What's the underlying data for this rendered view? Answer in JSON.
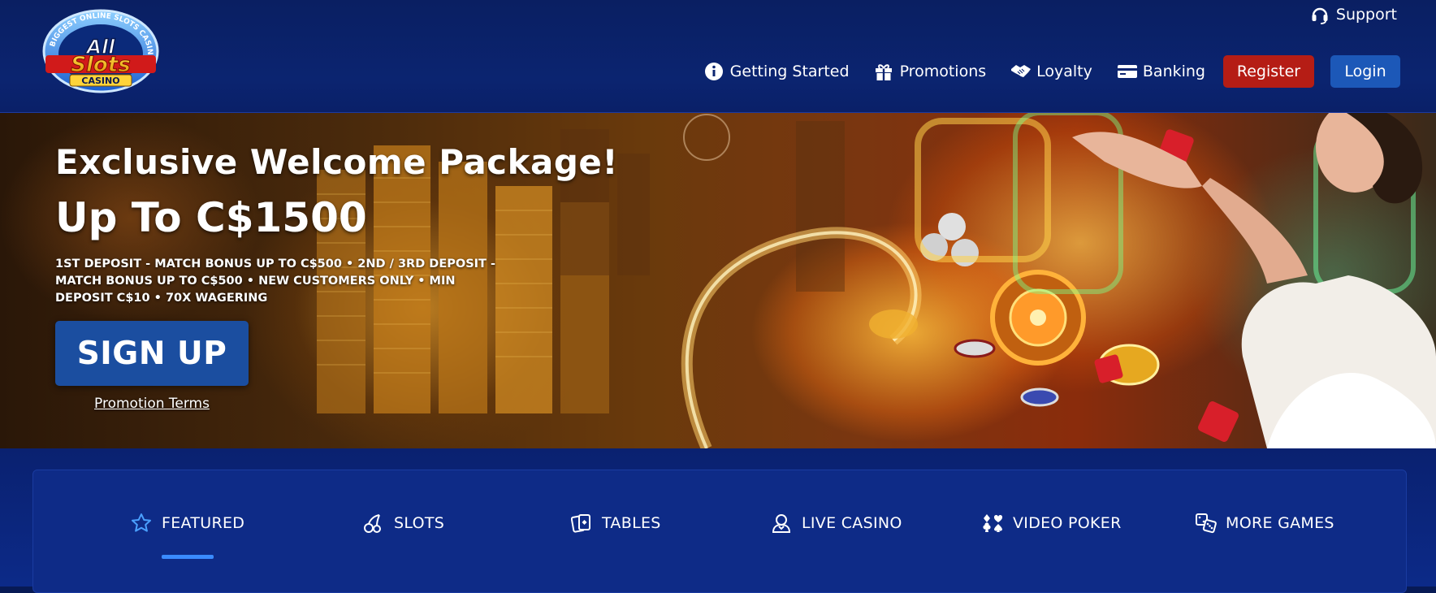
{
  "header": {
    "logo_alt": "All Slots Casino",
    "logo": {
      "ring_text": "BIGGEST ONLINE SLOTS CASINO",
      "line1": "All",
      "line2": "Slots",
      "line3": "CASINO"
    },
    "support_label": "Support",
    "nav": [
      {
        "label": "Getting Started",
        "icon": "info-icon"
      },
      {
        "label": "Promotions",
        "icon": "gift-icon"
      },
      {
        "label": "Loyalty",
        "icon": "handshake-icon"
      },
      {
        "label": "Banking",
        "icon": "credit-card-icon"
      }
    ],
    "register_label": "Register",
    "login_label": "Login"
  },
  "hero": {
    "title": "Exclusive Welcome Package!",
    "amount": "Up To C$1500",
    "terms": "1ST DEPOSIT - MATCH BONUS UP TO C$500 • 2ND / 3RD DEPOSIT - MATCH BONUS UP TO C$500 • NEW CUSTOMERS ONLY • MIN DEPOSIT C$10 • 70X WAGERING",
    "signup_label": "SIGN UP",
    "promo_link": "Promotion Terms"
  },
  "games": {
    "tabs": [
      {
        "label": "FEATURED",
        "icon": "star-icon",
        "active": true
      },
      {
        "label": "SLOTS",
        "icon": "cherries-icon",
        "active": false
      },
      {
        "label": "TABLES",
        "icon": "cards-icon",
        "active": false
      },
      {
        "label": "LIVE CASINO",
        "icon": "dealer-icon",
        "active": false
      },
      {
        "label": "VIDEO POKER",
        "icon": "card-suits-icon",
        "active": false
      },
      {
        "label": "MORE GAMES",
        "icon": "dice-icon",
        "active": false
      }
    ]
  },
  "colors": {
    "header_bg": "#0b2470",
    "register": "#b51d15",
    "login": "#1c58b8",
    "signup": "#1b4ea0",
    "active_tab_underline": "#3a8bff"
  }
}
